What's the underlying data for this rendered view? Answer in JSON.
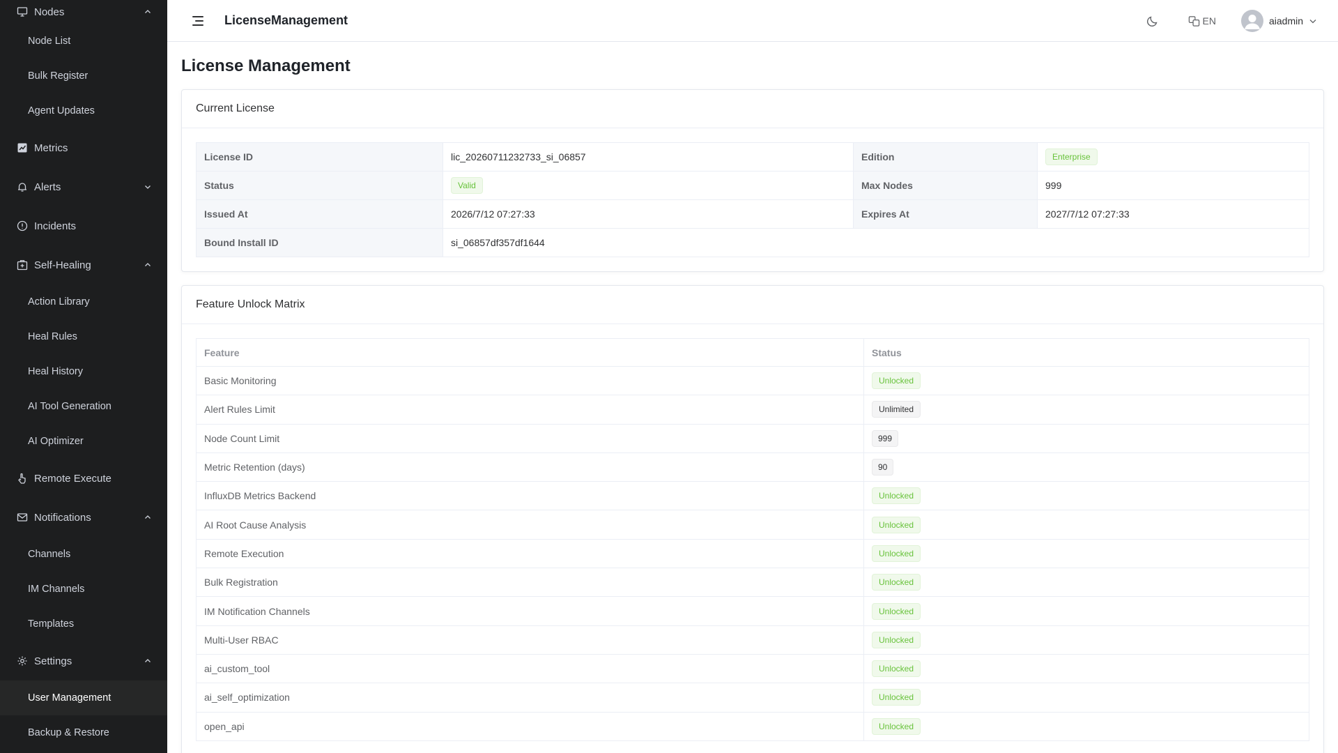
{
  "sidebar": {
    "nodes": {
      "label": "Nodes",
      "items": [
        "Node List",
        "Bulk Register",
        "Agent Updates"
      ]
    },
    "metrics": {
      "label": "Metrics"
    },
    "alerts": {
      "label": "Alerts"
    },
    "incidents": {
      "label": "Incidents"
    },
    "self_healing": {
      "label": "Self-Healing",
      "items": [
        "Action Library",
        "Heal Rules",
        "Heal History",
        "AI Tool Generation",
        "AI Optimizer"
      ]
    },
    "remote_execute": {
      "label": "Remote Execute"
    },
    "notifications": {
      "label": "Notifications",
      "items": [
        "Channels",
        "IM Channels",
        "Templates"
      ]
    },
    "settings": {
      "label": "Settings",
      "items": [
        "User Management",
        "Backup & Restore"
      ]
    }
  },
  "header": {
    "app_title": "LicenseManagement",
    "language": "EN",
    "username": "aiadmin"
  },
  "page": {
    "title": "License Management"
  },
  "current_license": {
    "title": "Current License",
    "license_id_label": "License ID",
    "license_id": "lic_20260711232733_si_06857",
    "edition_label": "Edition",
    "edition": "Enterprise",
    "status_label": "Status",
    "status": "Valid",
    "max_nodes_label": "Max Nodes",
    "max_nodes": "999",
    "issued_at_label": "Issued At",
    "issued_at": "2026/7/12 07:27:33",
    "expires_at_label": "Expires At",
    "expires_at": "2027/7/12 07:27:33",
    "bound_install_label": "Bound Install ID",
    "bound_install_id": "si_06857df357df1644"
  },
  "feature_matrix": {
    "title": "Feature Unlock Matrix",
    "columns": [
      "Feature",
      "Status"
    ],
    "rows": [
      {
        "feature": "Basic Monitoring",
        "status": "Unlocked",
        "type": "success"
      },
      {
        "feature": "Alert Rules Limit",
        "status": "Unlimited",
        "type": "info"
      },
      {
        "feature": "Node Count Limit",
        "status": "999",
        "type": "info"
      },
      {
        "feature": "Metric Retention (days)",
        "status": "90",
        "type": "info"
      },
      {
        "feature": "InfluxDB Metrics Backend",
        "status": "Unlocked",
        "type": "success"
      },
      {
        "feature": "AI Root Cause Analysis",
        "status": "Unlocked",
        "type": "success"
      },
      {
        "feature": "Remote Execution",
        "status": "Unlocked",
        "type": "success"
      },
      {
        "feature": "Bulk Registration",
        "status": "Unlocked",
        "type": "success"
      },
      {
        "feature": "IM Notification Channels",
        "status": "Unlocked",
        "type": "success"
      },
      {
        "feature": "Multi-User RBAC",
        "status": "Unlocked",
        "type": "success"
      },
      {
        "feature": "ai_custom_tool",
        "status": "Unlocked",
        "type": "success"
      },
      {
        "feature": "ai_self_optimization",
        "status": "Unlocked",
        "type": "success"
      },
      {
        "feature": "open_api",
        "status": "Unlocked",
        "type": "success"
      }
    ]
  }
}
